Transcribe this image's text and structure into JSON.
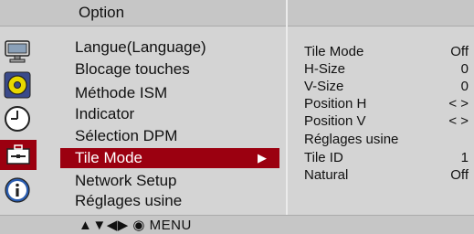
{
  "header": {
    "title": "Option"
  },
  "side_icons": [
    "monitor-icon",
    "disc-icon",
    "clock-icon",
    "toolbox-icon",
    "info-icon"
  ],
  "menu": {
    "items": [
      {
        "label": "Langue(Language)"
      },
      {
        "label": "Blocage touches"
      },
      {
        "label": "Méthode ISM"
      },
      {
        "label": "Indicator"
      },
      {
        "label": "Sélection DPM"
      },
      {
        "label": "Tile Mode",
        "arrow": "▶"
      },
      {
        "label": "Network Setup"
      },
      {
        "label": "Réglages usine"
      }
    ],
    "selected_index": 5
  },
  "details": {
    "rows": [
      {
        "label": "Tile Mode",
        "value": "Off"
      },
      {
        "label": "H-Size",
        "value": "0"
      },
      {
        "label": "V-Size",
        "value": "0"
      },
      {
        "label": "Position H",
        "value": "< >"
      },
      {
        "label": "Position V",
        "value": "< >"
      },
      {
        "label": "Réglages usine",
        "value": ""
      },
      {
        "label": "Tile ID",
        "value": "1"
      },
      {
        "label": "Natural",
        "value": "Off"
      }
    ]
  },
  "footer": {
    "nav_hint": "▲▼◀▶ ◉ MENU"
  },
  "colors": {
    "selection": "#9b0010",
    "panel": "#d4d4d4",
    "bar": "#c6c6c6"
  }
}
